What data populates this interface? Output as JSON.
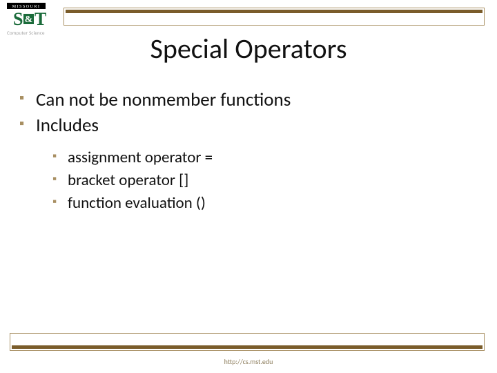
{
  "logo": {
    "missouri_label": "MISSOURI",
    "big_s": "S",
    "amp": "&",
    "big_t": "T",
    "subline": "Computer Science"
  },
  "title": "Special Operators",
  "bullets": [
    {
      "text": "Can not be nonmember functions",
      "children": []
    },
    {
      "text": "Includes",
      "children": [
        {
          "text": "assignment operator ="
        },
        {
          "text": "bracket operator []"
        },
        {
          "text": "function evaluation ()"
        }
      ]
    }
  ],
  "footer": "http://cs.mst.edu",
  "colors": {
    "accent": "#a88f62",
    "accent_dark": "#7a5c2a",
    "logo_green": "#1a6b3a"
  }
}
